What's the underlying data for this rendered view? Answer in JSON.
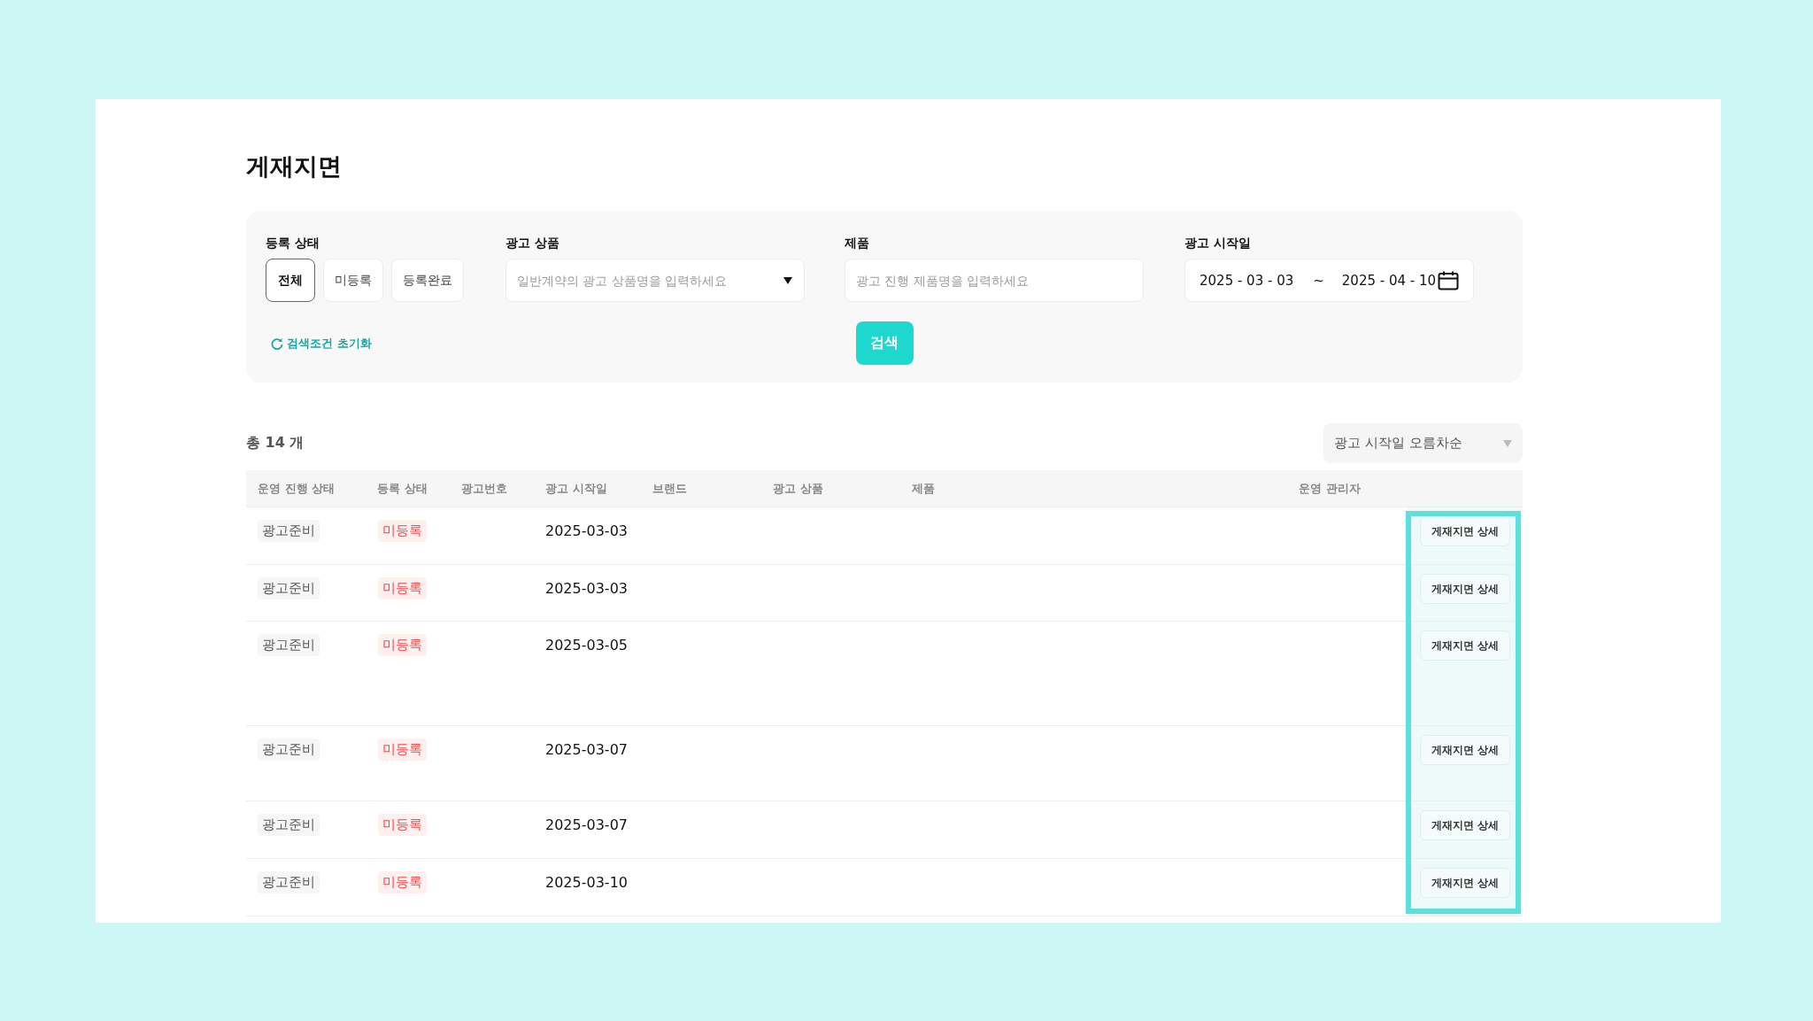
{
  "page": {
    "title": "게재지면"
  },
  "filters": {
    "status": {
      "label": "등록 상태",
      "options": [
        {
          "label": "전체",
          "selected": true
        },
        {
          "label": "미등록",
          "selected": false
        },
        {
          "label": "등록완료",
          "selected": false
        }
      ]
    },
    "product": {
      "label": "광고 상품",
      "placeholder": "일반계약의 광고 상품명을 입력하세요"
    },
    "item": {
      "label": "제품",
      "placeholder": "광고 진행 제품명을 입력하세요"
    },
    "start_date": {
      "label": "광고 시작일",
      "from": "2025 - 03 - 03",
      "separator": "~",
      "to": "2025 - 04 - 10"
    },
    "reset": "검색조건 초기화",
    "search_button": "검색"
  },
  "results": {
    "total": "총 14 개",
    "sort": "광고 시작일 오름차순"
  },
  "table": {
    "columns": [
      "운영 진행 상태",
      "등록 상태",
      "광고번호",
      "광고 시작일",
      "브랜드",
      "광고 상품",
      "제품",
      "운영 관리자"
    ],
    "rows": [
      {
        "progress": "광고준비",
        "registration": "미등록",
        "start_date": "2025-03-03",
        "action": "게재지면 상세"
      },
      {
        "progress": "광고준비",
        "registration": "미등록",
        "start_date": "2025-03-03",
        "action": "게재지면 상세"
      },
      {
        "progress": "광고준비",
        "registration": "미등록",
        "start_date": "2025-03-05",
        "action": "게재지면 상세"
      },
      {
        "progress": "광고준비",
        "registration": "미등록",
        "start_date": "2025-03-07",
        "action": "게재지면 상세"
      },
      {
        "progress": "광고준비",
        "registration": "미등록",
        "start_date": "2025-03-07",
        "action": "게재지면 상세"
      },
      {
        "progress": "광고준비",
        "registration": "미등록",
        "start_date": "2025-03-10",
        "action": "게재지면 상세"
      }
    ]
  }
}
